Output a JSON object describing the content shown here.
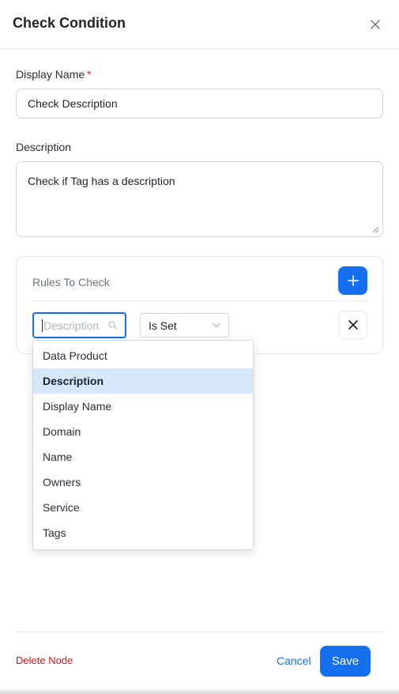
{
  "dialog": {
    "title": "Check Condition"
  },
  "form": {
    "display_name_label": "Display Name",
    "required_mark": "*",
    "display_name_value": "Check Description",
    "description_label": "Description",
    "description_value": "Check if Tag has a description"
  },
  "rules": {
    "title": "Rules To Check",
    "field_placeholder": "Description",
    "operator_value": "Is Set"
  },
  "dropdown": {
    "options": [
      "Data Product",
      "Description",
      "Display Name",
      "Domain",
      "Name",
      "Owners",
      "Service",
      "Tags"
    ],
    "selected": "Description"
  },
  "footer": {
    "delete_label": "Delete Node",
    "cancel_label": "Cancel",
    "save_label": "Save"
  },
  "colors": {
    "accent": "#1570ef",
    "danger": "#c81e1e",
    "selected_bg": "#d5e8fd"
  },
  "icons": {
    "close": "close-icon",
    "add": "plus-icon",
    "search": "search-icon",
    "chevron": "chevron-down-icon",
    "remove": "x-icon"
  }
}
